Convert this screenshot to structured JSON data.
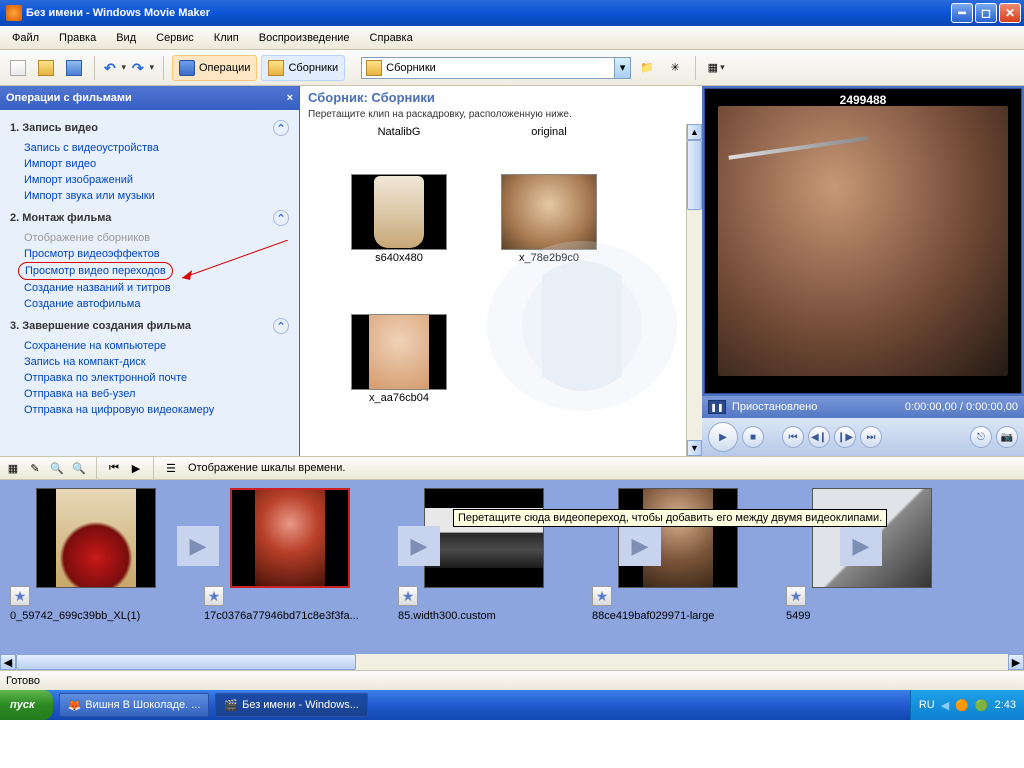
{
  "titlebar": {
    "text": "Без имени - Windows Movie Maker"
  },
  "menu": {
    "file": "Файл",
    "edit": "Правка",
    "view": "Вид",
    "tools": "Сервис",
    "clip": "Клип",
    "play": "Воспроизведение",
    "help": "Справка"
  },
  "toolbar": {
    "operations": "Операции",
    "collections": "Сборники",
    "combo_value": "Сборники"
  },
  "tasks": {
    "header": "Операции с фильмами",
    "sec1": {
      "title": "1. Запись видео",
      "i1": "Запись с видеоустройства",
      "i2": "Импорт видео",
      "i3": "Импорт изображений",
      "i4": "Импорт звука или музыки"
    },
    "sec2": {
      "title": "2. Монтаж фильма",
      "i1": "Отображение сборников",
      "i2": "Просмотр видеоэффектов",
      "i3": "Просмотр видео переходов",
      "i4": "Создание названий и титров",
      "i5": "Создание автофильма"
    },
    "sec3": {
      "title": "3. Завершение создания фильма",
      "i1": "Сохранение на компьютере",
      "i2": "Запись на компакт-диск",
      "i3": "Отправка по электронной почте",
      "i4": "Отправка на веб-узел",
      "i5": "Отправка на цифровую видеокамеру"
    }
  },
  "collection": {
    "title": "Сборник: Сборники",
    "subtitle": "Перетащите клип на раскадровку, расположенную ниже.",
    "c1": "NatalibG",
    "c2": "original",
    "c3": "s640x480",
    "c4": "x_78e2b9c0",
    "c5": "x_aa76cb04"
  },
  "preview": {
    "title": "2499488",
    "status_icon": "❚❚",
    "status": "Приостановлено",
    "time": "0:00:00,00 / 0:00:00,00"
  },
  "timeline": {
    "label": "Отображение шкалы времени."
  },
  "storyboard": {
    "s1": "0_59742_699c39bb_XL(1)",
    "s2": "17c0376a77946bd71c8e3f3fa...",
    "s3": "85.width300.custom",
    "s4": "88ce419baf029971-large",
    "s5": "5499",
    "tooltip": "Перетащите сюда видеопереход, чтобы добавить его между двумя видеоклипами."
  },
  "status": {
    "text": "Готово"
  },
  "taskbar": {
    "start": "пуск",
    "t1": "Вишня В Шоколаде. ...",
    "t2": "Без имени - Windows...",
    "lang": "RU",
    "clock": "2:43"
  }
}
